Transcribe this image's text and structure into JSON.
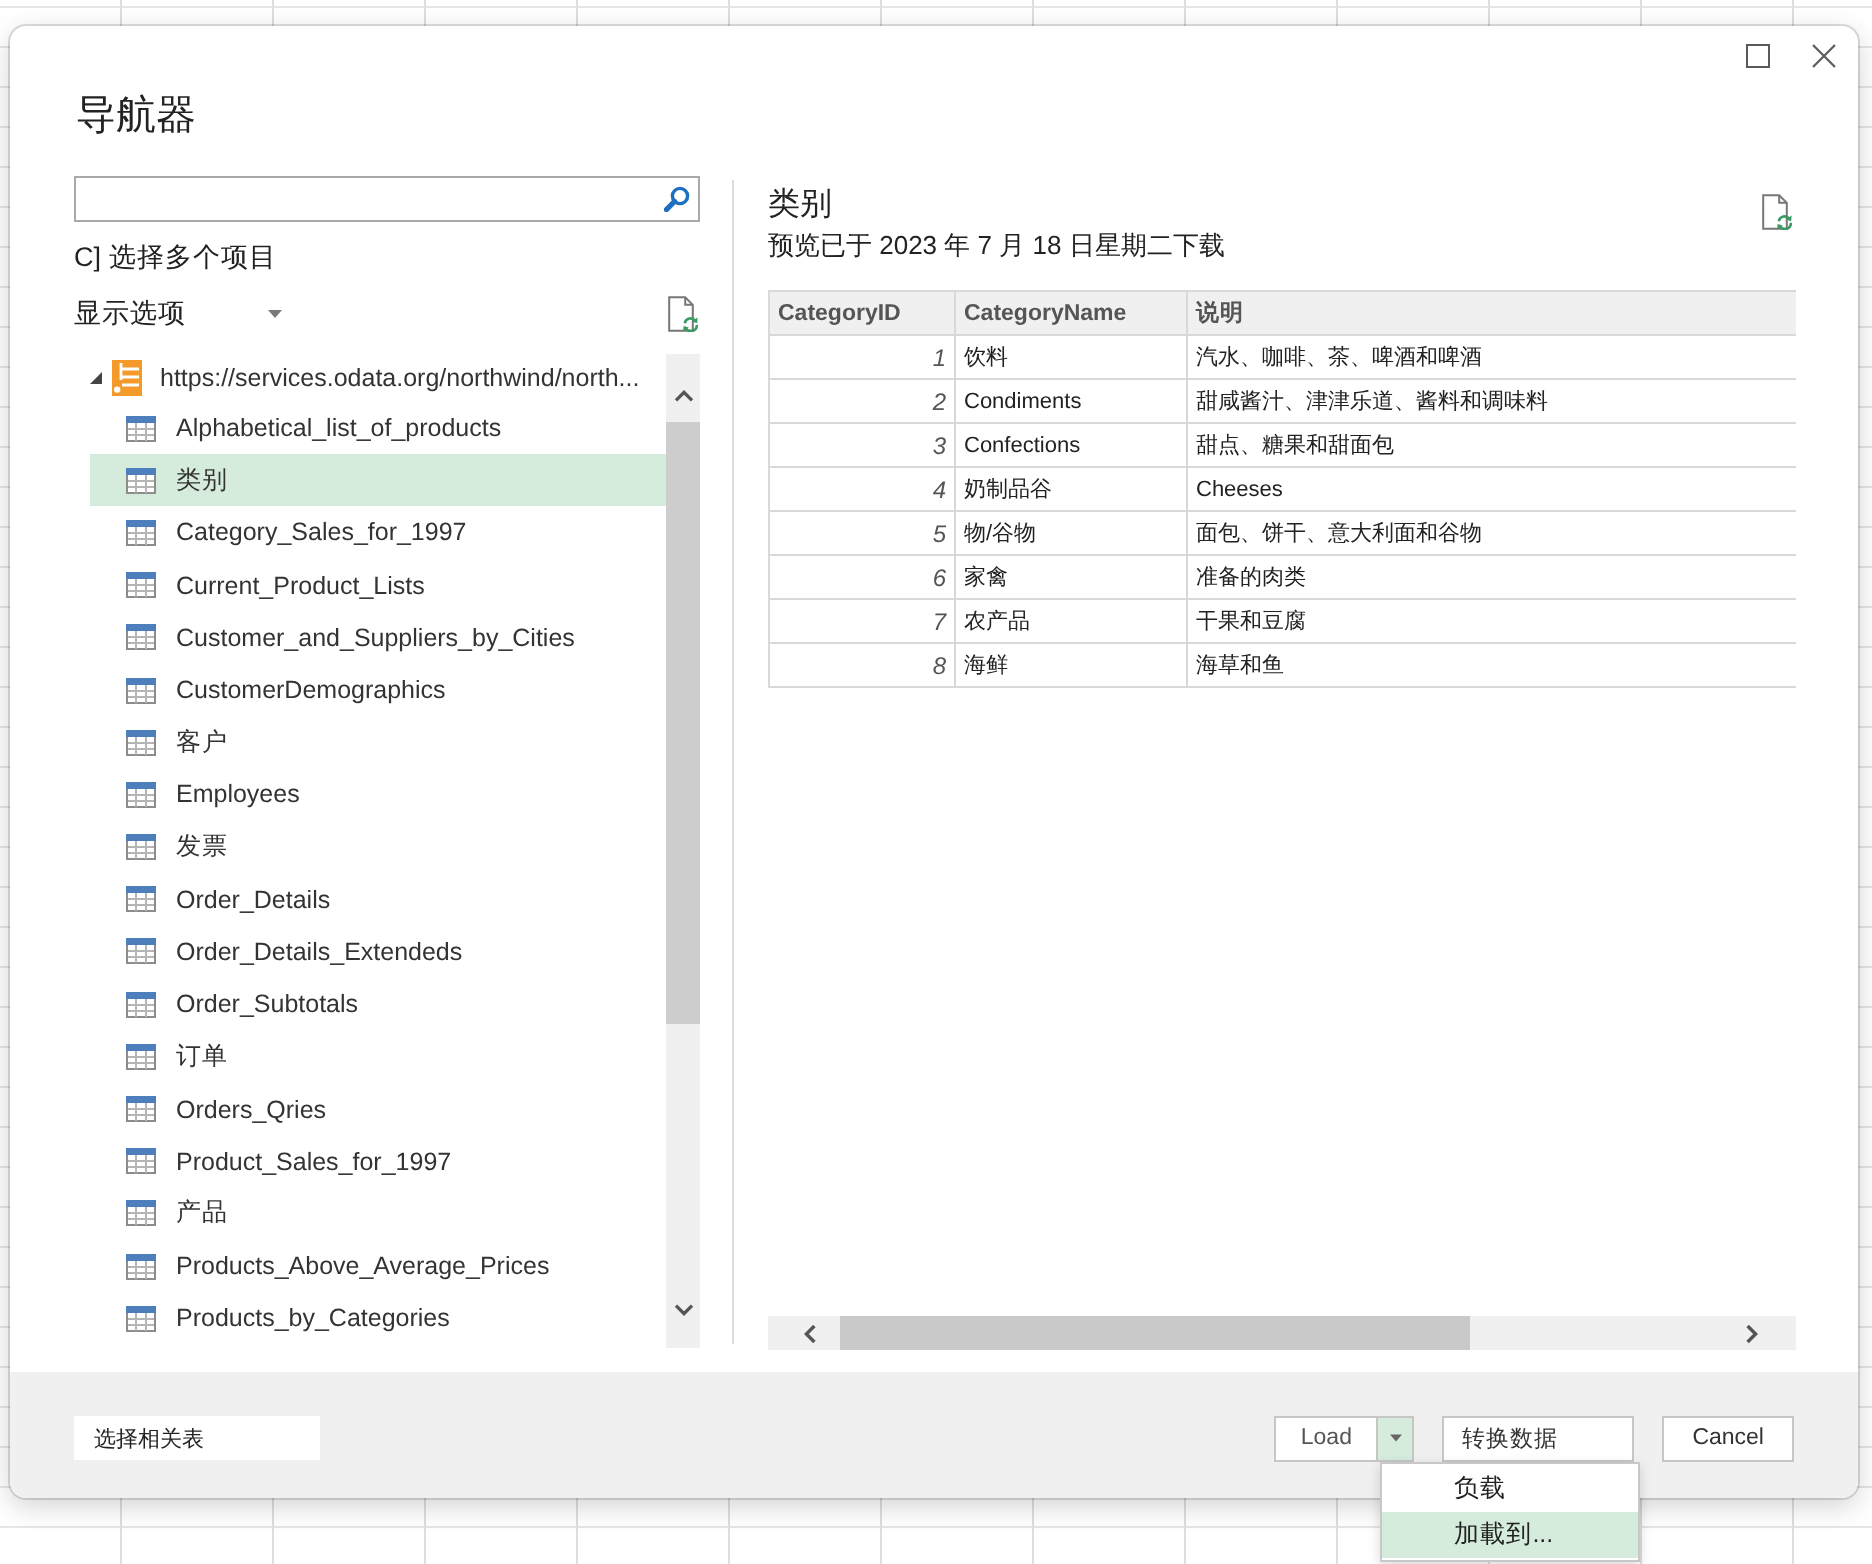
{
  "window": {
    "title": "导航器"
  },
  "select_multiple": {
    "label": "C] 选择多个项目"
  },
  "display_options": {
    "label": "显示选项"
  },
  "tree": {
    "root": {
      "label": "https://services.odata.org/northwind/north...",
      "expanded": true,
      "children": [
        {
          "label": "Alphabetical_list_of_products",
          "selected": false
        },
        {
          "label": "类别",
          "selected": true
        },
        {
          "label": "Category_Sales_for_1997",
          "selected": false
        },
        {
          "label": "Current_Product_Lists",
          "selected": false
        },
        {
          "label": "Customer_and_Suppliers_by_Cities",
          "selected": false
        },
        {
          "label": "CustomerDemographics",
          "selected": false
        },
        {
          "label": "客户",
          "selected": false
        },
        {
          "label": "Employees",
          "selected": false
        },
        {
          "label": "发票",
          "selected": false
        },
        {
          "label": "Order_Details",
          "selected": false
        },
        {
          "label": "Order_Details_Extendeds",
          "selected": false
        },
        {
          "label": "Order_Subtotals",
          "selected": false
        },
        {
          "label": "订单",
          "selected": false
        },
        {
          "label": "Orders_Qries",
          "selected": false
        },
        {
          "label": "Product_Sales_for_1997",
          "selected": false
        },
        {
          "label": "产品",
          "selected": false
        },
        {
          "label": "Products_Above_Average_Prices",
          "selected": false
        },
        {
          "label": "Products_by_Categories",
          "selected": false
        }
      ]
    }
  },
  "preview": {
    "title": "类别",
    "subtitle": "预览已于 2023 年 7 月 18 日星期二下载",
    "table": {
      "columns": [
        {
          "label": "CategoryID",
          "kind": "number"
        },
        {
          "label": "CategoryName",
          "kind": "text"
        },
        {
          "label": "说明",
          "kind": "text"
        }
      ],
      "rows": [
        [
          "1",
          "饮料",
          "汽水、咖啡、茶、啤酒和啤酒"
        ],
        [
          "2",
          "Condiments",
          "甜咸酱汁、津津乐道、酱料和调味料"
        ],
        [
          "3",
          "Confections",
          "甜点、糖果和甜面包"
        ],
        [
          "4",
          "奶制品谷",
          "Cheeses"
        ],
        [
          "5",
          "物/谷物",
          "面包、饼干、意大利面和谷物"
        ],
        [
          "6",
          "家禽",
          "准备的肉类"
        ],
        [
          "7",
          "农产品",
          "干果和豆腐"
        ],
        [
          "8",
          "海鲜",
          "海草和鱼"
        ]
      ]
    }
  },
  "footer": {
    "secondary_button": {
      "label": "选择相关表"
    },
    "buttons": [
      {
        "label": "Load",
        "kind": "split",
        "expanded": true,
        "menu": [
          {
            "label": "负载",
            "selected": false
          },
          {
            "label": "加載到...",
            "selected": true
          }
        ]
      },
      {
        "label": "转换数据",
        "kind": "plain"
      },
      {
        "label": "Cancel",
        "kind": "plain"
      }
    ]
  }
}
